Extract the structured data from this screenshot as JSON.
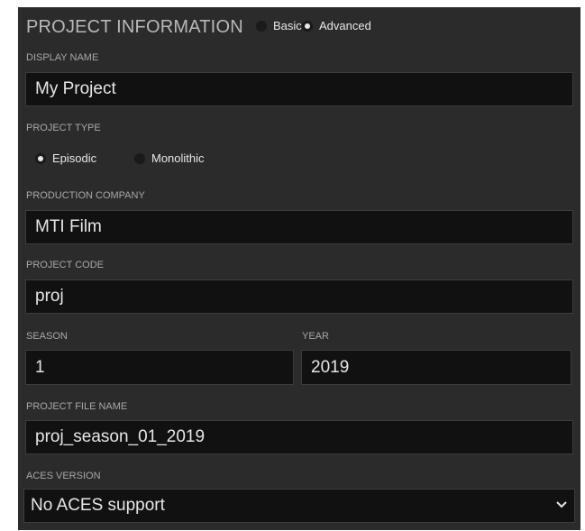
{
  "header": {
    "title": "PROJECT INFORMATION",
    "mode_options": [
      {
        "label": "Basic",
        "selected": false
      },
      {
        "label": "Advanced",
        "selected": true
      }
    ]
  },
  "display_name": {
    "label": "DISPLAY NAME",
    "value": "My Project"
  },
  "project_type": {
    "label": "PROJECT TYPE",
    "options": [
      {
        "label": "Episodic",
        "selected": true
      },
      {
        "label": "Monolithic",
        "selected": false
      }
    ]
  },
  "production_company": {
    "label": "PRODUCTION COMPANY",
    "value": "MTI Film"
  },
  "project_code": {
    "label": "PROJECT CODE",
    "value": "proj"
  },
  "season": {
    "label": "SEASON",
    "value": "1"
  },
  "year": {
    "label": "YEAR",
    "value": "2019"
  },
  "project_file_name": {
    "label": "PROJECT FILE NAME",
    "value": "proj_season_01_2019"
  },
  "aces_version": {
    "label": "ACES VERSION",
    "selected": "No ACES support"
  },
  "colors": {
    "panel": "#2b2b2b",
    "field": "#111111",
    "text": "#e6e6e6",
    "label": "#a8a8a8"
  }
}
